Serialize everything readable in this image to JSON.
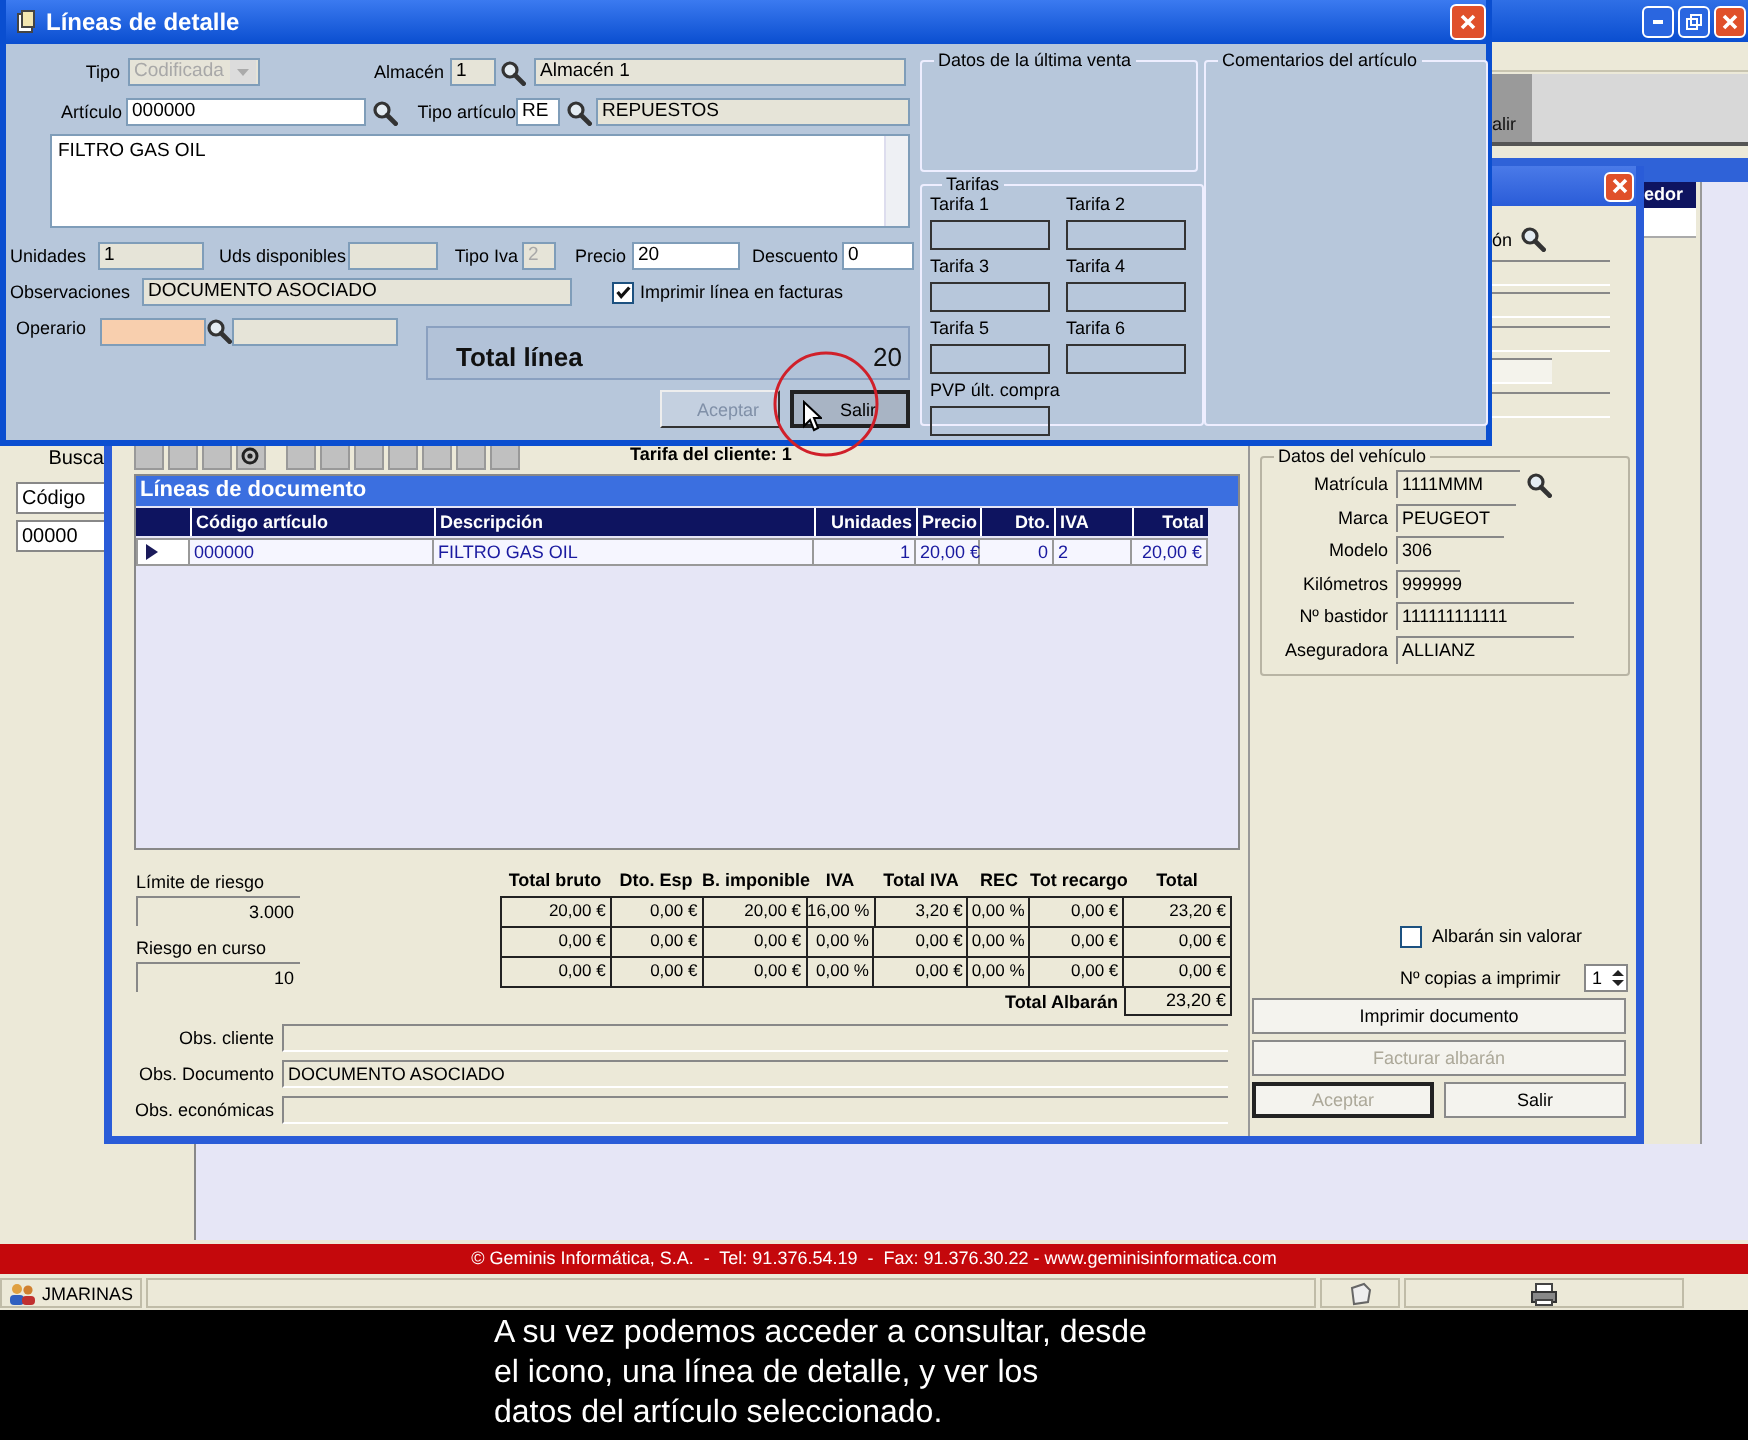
{
  "app": {
    "toolbar_fragment": "alir",
    "search_panel": {
      "label": "Busca",
      "field_label": "Código",
      "field_value": "00000"
    },
    "grid_header_fragment": "edor",
    "label_fragment": "ón"
  },
  "detail_dialog": {
    "title": "Líneas de detalle",
    "tipo": {
      "label": "Tipo",
      "value": "Codificada",
      "disabled": true
    },
    "almacen": {
      "label": "Almacén",
      "code": "1",
      "name": "Almacén 1"
    },
    "articulo": {
      "label": "Artículo",
      "value": "000000"
    },
    "tipo_articulo": {
      "label": "Tipo artículo",
      "code": "RE",
      "name": "REPUESTOS"
    },
    "descripcion": "FILTRO GAS OIL",
    "unidades": {
      "label": "Unidades",
      "value": "1"
    },
    "uds_disponibles": {
      "label": "Uds disponibles"
    },
    "tipo_iva": {
      "label": "Tipo Iva",
      "value": "2",
      "disabled": true
    },
    "precio": {
      "label": "Precio",
      "value": "20"
    },
    "descuento": {
      "label": "Descuento",
      "value": "0"
    },
    "observaciones": {
      "label": "Observaciones",
      "value": "DOCUMENTO ASOCIADO"
    },
    "imprimir": {
      "label": "Imprimir línea en facturas",
      "checked": true
    },
    "operario": {
      "label": "Operario"
    },
    "total": {
      "label": "Total línea",
      "value": "20"
    },
    "buttons": [
      {
        "label": "Aceptar",
        "disabled": true
      },
      {
        "label": "Salir",
        "disabled": false
      }
    ],
    "ultima_venta": {
      "title": "Datos de la última venta"
    },
    "tarifas": {
      "title": "Tarifas",
      "items": [
        {
          "label": "Tarifa 1"
        },
        {
          "label": "Tarifa 2"
        },
        {
          "label": "Tarifa 3"
        },
        {
          "label": "Tarifa 4"
        },
        {
          "label": "Tarifa 5"
        },
        {
          "label": "Tarifa 6"
        },
        {
          "label": "PVP últ. compra"
        }
      ]
    },
    "comentarios": {
      "title": "Comentarios del artículo"
    }
  },
  "document_window": {
    "tarifa_cliente": "Tarifa del cliente: 1",
    "grid": {
      "title": "Líneas de documento",
      "columns": [
        "Código artículo",
        "Descripción",
        "Unidades",
        "Precio",
        "Dto.",
        "IVA",
        "Total"
      ],
      "rows": [
        {
          "selected": true,
          "cells": [
            "000000",
            "FILTRO GAS OIL",
            "1",
            "20,00 €",
            "0",
            "2",
            "20,00 €"
          ]
        }
      ]
    },
    "riesgo": [
      {
        "label": "Límite de riesgo",
        "value": "3.000"
      },
      {
        "label": "Riesgo en curso",
        "value": "10"
      }
    ],
    "totals": {
      "columns": [
        "Total bruto",
        "Dto. Esp",
        "B. imponible",
        "IVA",
        "Total IVA",
        "REC",
        "Tot recargo",
        "Total"
      ],
      "rows": [
        [
          "20,00 €",
          "0,00 €",
          "20,00 €",
          "16,00 %",
          "3,20 €",
          "0,00 %",
          "0,00 €",
          "23,20 €"
        ],
        [
          "0,00 €",
          "0,00 €",
          "0,00 €",
          "0,00 %",
          "0,00 €",
          "0,00 %",
          "0,00 €",
          "0,00 €"
        ],
        [
          "0,00 €",
          "0,00 €",
          "0,00 €",
          "0,00 %",
          "0,00 €",
          "0,00 %",
          "0,00 €",
          "0,00 €"
        ]
      ],
      "total_label": "Total Albarán",
      "total_value": "23,20 €"
    },
    "observations": [
      {
        "label": "Obs. cliente"
      },
      {
        "label": "Obs. Documento",
        "value": "DOCUMENTO ASOCIADO"
      },
      {
        "label": "Obs. económicas"
      }
    ],
    "vehicle": {
      "title": "Datos del vehículo",
      "fields": [
        {
          "label": "Matrícula",
          "value": "1111MMM",
          "search": true
        },
        {
          "label": "Marca",
          "value": "PEUGEOT",
          "search": false
        },
        {
          "label": "Modelo",
          "value": "306",
          "search": false
        },
        {
          "label": "Kilómetros",
          "value": "999999",
          "search": false
        },
        {
          "label": "Nº bastidor",
          "value": "111111111111",
          "search": false
        },
        {
          "label": "Aseguradora",
          "value": "ALLIANZ",
          "search": false
        }
      ]
    },
    "sin_valorar": {
      "label": "Albarán sin valorar",
      "checked": false
    },
    "copias": {
      "label": "Nº copias a imprimir",
      "value": "1"
    },
    "buttons": [
      {
        "label": "Imprimir documento",
        "disabled": false
      },
      {
        "label": "Facturar albarán",
        "disabled": true
      },
      {
        "label": "Aceptar",
        "disabled": true
      },
      {
        "label": "Salir",
        "disabled": false
      }
    ]
  },
  "footer": "© Geminis Informática, S.A.  -  Tel: 91.376.54.19  -  Fax: 91.376.30.22 - www.geminisinformatica.com",
  "status_bar": {
    "user": "JMARINAS"
  },
  "caption": [
    "A su vez podemos acceder a consultar,  desde",
    "el icono, una línea de detalle, y  ver los",
    "datos del artículo seleccionado."
  ]
}
